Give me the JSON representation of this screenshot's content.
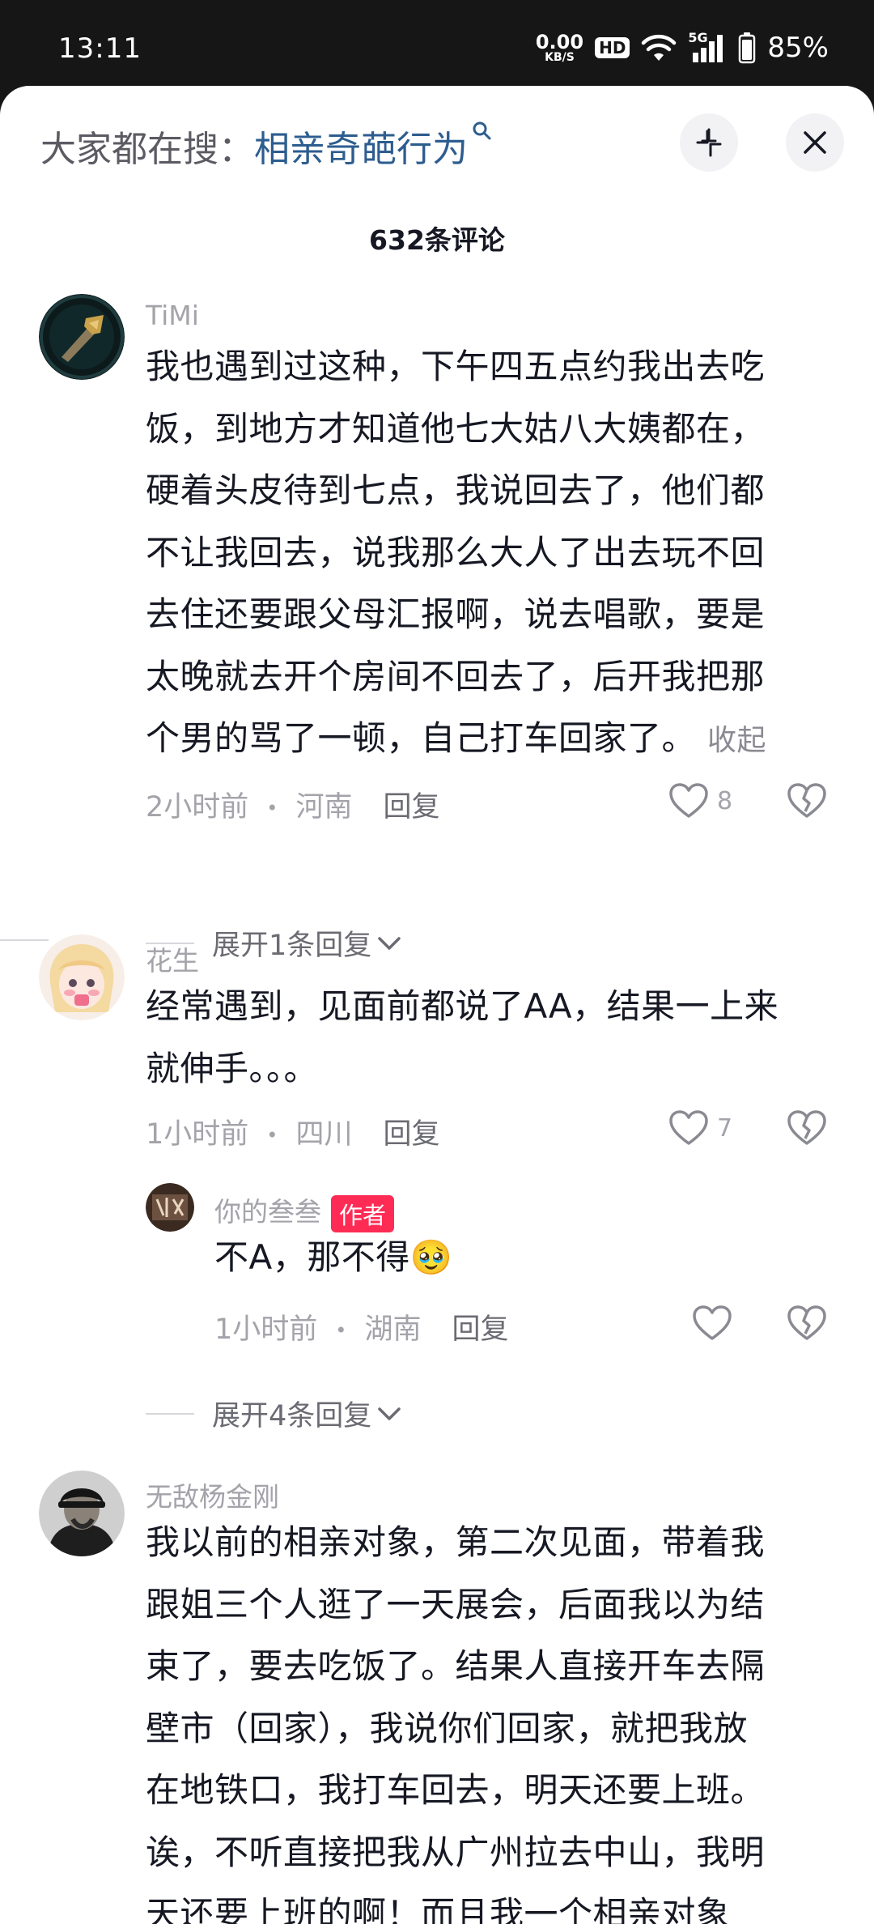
{
  "status_bar": {
    "time": "13:11",
    "net_speed": "0.00",
    "net_unit": "KB/S",
    "hd": "HD",
    "network": "5G",
    "battery": "85%"
  },
  "header": {
    "search_prefix": "大家都在搜：",
    "search_keyword": "相亲奇葩行为",
    "comment_count": "632条评论"
  },
  "comments": [
    {
      "author": "TiMi",
      "lines": [
        "我也遇到过这种，下午四五点约我出去吃",
        "饭，到地方才知道他七大姑八大姨都在，",
        "硬着头皮待到七点，我说回去了，他们都",
        "不让我回去，说我那么大人了出去玩不回",
        "去住还要跟父母汇报啊，说去唱歌，要是",
        "太晚就去开个房间不回去了，后开我把那",
        "个男的骂了一顿，自己打车回家了。"
      ],
      "collapse": "收起",
      "time": "2小时前",
      "location": "河南",
      "reply": "回复",
      "likes": "8",
      "expand": "展开1条回复"
    },
    {
      "author": "花生",
      "lines": [
        "经常遇到，见面前都说了AA，结果一上来",
        "就伸手。。。"
      ],
      "time": "1小时前",
      "location": "四川",
      "reply": "回复",
      "likes": "7",
      "sub_reply": {
        "author": "你的叁叁",
        "badge": "作者",
        "text": "不A，那不得",
        "emoji": "🥹",
        "time": "1小时前",
        "location": "湖南",
        "reply": "回复"
      },
      "expand": "展开4条回复"
    },
    {
      "author": "无敌杨金刚",
      "lines": [
        "我以前的相亲对象，第二次见面，带着我",
        "跟姐三个人逛了一天展会，后面我以为结",
        "束了，要去吃饭了。结果人直接开车去隔",
        "壁市（回家），我说你们回家，就把我放",
        "在地铁口，我打车回去，明天还要上班。",
        "诶，不听直接把我从广州拉去中山，我明",
        "天还要上班的啊！而且我一个相亲对象"
      ]
    }
  ]
}
